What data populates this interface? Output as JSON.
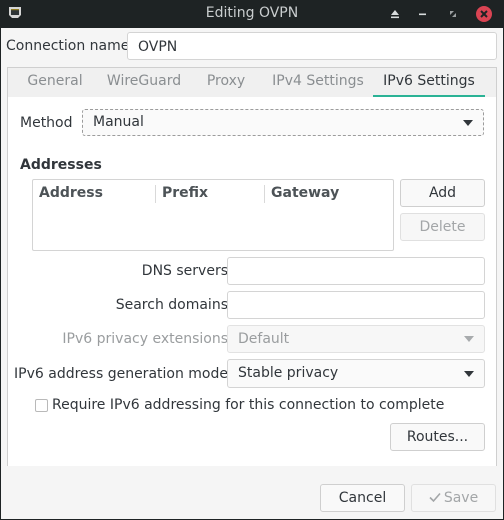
{
  "window": {
    "title": "Editing OVPN",
    "app_icon": "network-wired-icon",
    "controls": [
      "keep-above-icon",
      "minimize-icon",
      "maximize-icon",
      "close-icon"
    ]
  },
  "connection_name": {
    "label": "Connection name",
    "value": "OVPN"
  },
  "tabs": [
    {
      "label": "General",
      "active": false
    },
    {
      "label": "WireGuard",
      "active": false
    },
    {
      "label": "Proxy",
      "active": false
    },
    {
      "label": "IPv4 Settings",
      "active": false
    },
    {
      "label": "IPv6 Settings",
      "active": true
    }
  ],
  "ipv6": {
    "method": {
      "label": "Method",
      "value": "Manual"
    },
    "addresses": {
      "heading": "Addresses",
      "columns": [
        "Address",
        "Prefix",
        "Gateway"
      ],
      "rows": [],
      "add_label": "Add",
      "delete_label": "Delete"
    },
    "dns_servers": {
      "label": "DNS servers",
      "value": ""
    },
    "search_domains": {
      "label": "Search domains",
      "value": ""
    },
    "privacy_extensions": {
      "label": "IPv6 privacy extensions",
      "value": "Default",
      "enabled": false
    },
    "address_generation_mode": {
      "label": "IPv6 address generation mode",
      "value": "Stable privacy"
    },
    "require_ipv6": {
      "label": "Require IPv6 addressing for this connection to complete",
      "checked": false
    },
    "routes_label": "Routes..."
  },
  "footer": {
    "cancel_label": "Cancel",
    "save_label": "Save",
    "save_enabled": false
  },
  "colors": {
    "accent": "#2ab295",
    "close_button": "#da4453",
    "titlebar": "#1e2324"
  }
}
